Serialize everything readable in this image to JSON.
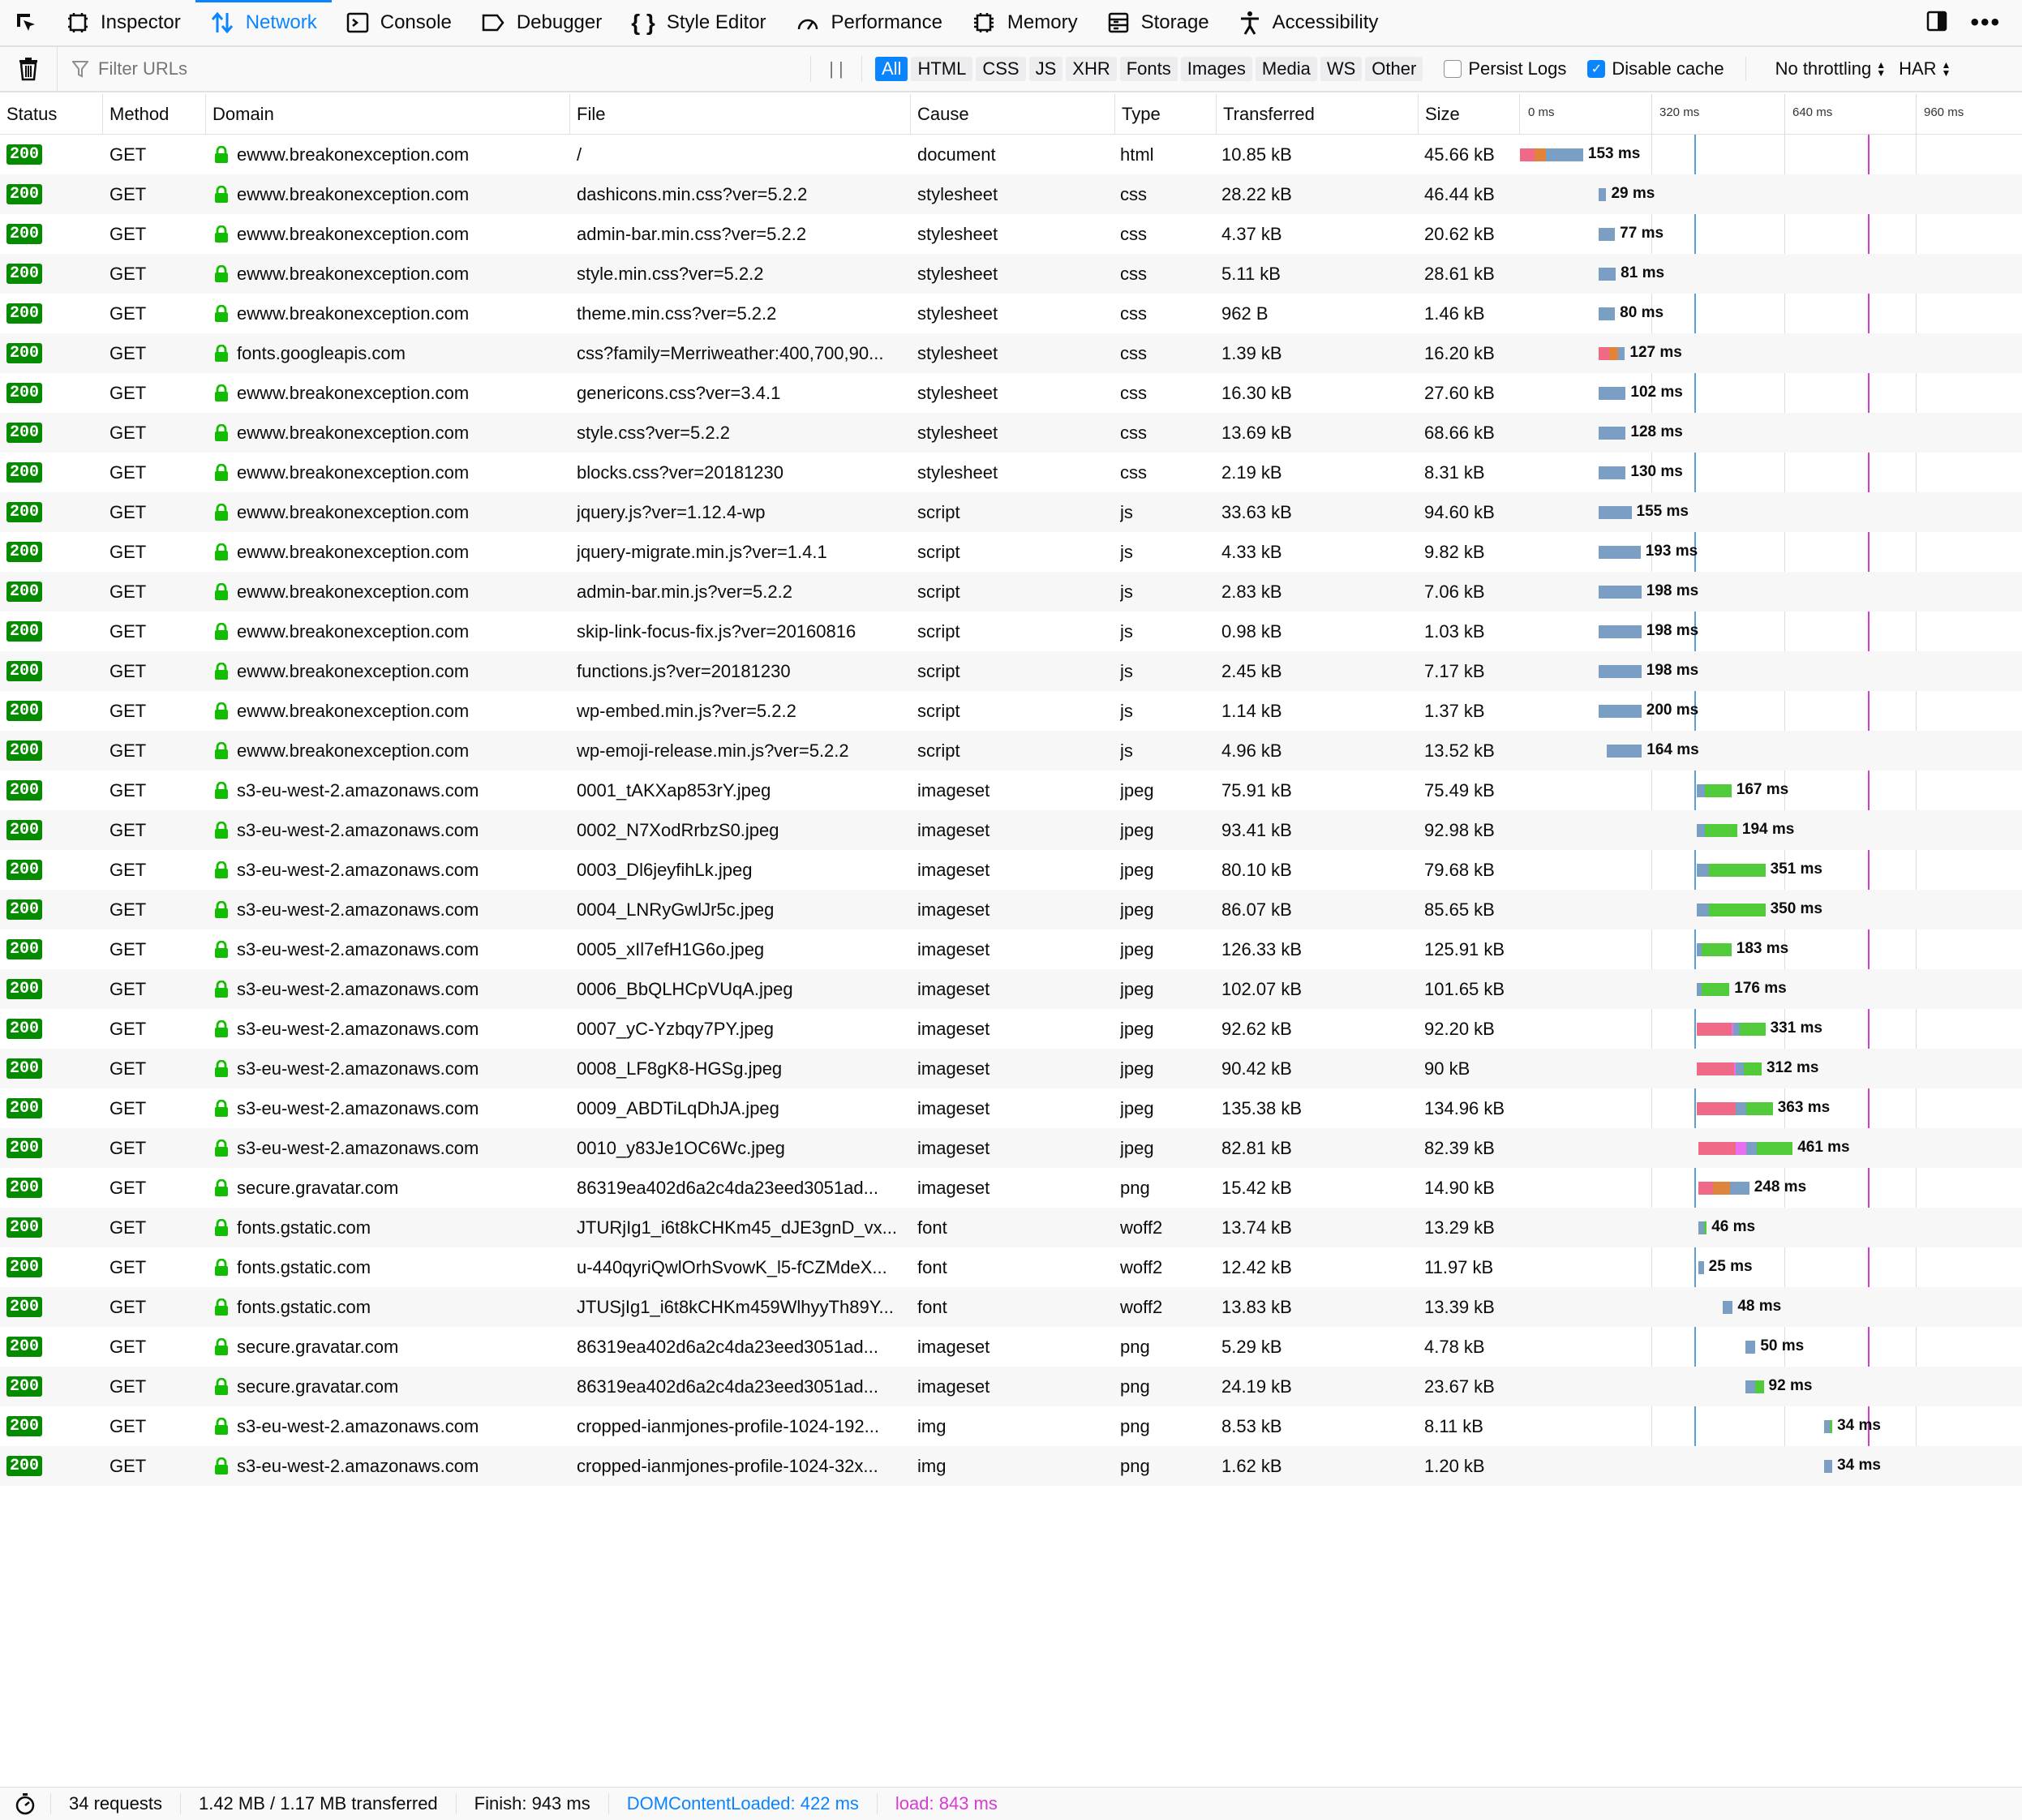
{
  "tabs": [
    {
      "label": "Inspector",
      "icon": "inspector-icon"
    },
    {
      "label": "Network",
      "icon": "network-icon",
      "selected": true
    },
    {
      "label": "Console",
      "icon": "console-icon"
    },
    {
      "label": "Debugger",
      "icon": "debugger-icon"
    },
    {
      "label": "Style Editor",
      "icon": "style-editor-icon"
    },
    {
      "label": "Performance",
      "icon": "performance-icon"
    },
    {
      "label": "Memory",
      "icon": "memory-icon"
    },
    {
      "label": "Storage",
      "icon": "storage-icon"
    },
    {
      "label": "Accessibility",
      "icon": "accessibility-icon"
    }
  ],
  "toolbar": {
    "filter_placeholder": "Filter URLs",
    "pause_label": "| |",
    "filter_types": [
      "All",
      "HTML",
      "CSS",
      "JS",
      "XHR",
      "Fonts",
      "Images",
      "Media",
      "WS",
      "Other"
    ],
    "selected_type": "All",
    "persist_logs": "Persist Logs",
    "persist_checked": false,
    "disable_cache": "Disable cache",
    "disable_checked": true,
    "throttling": "No throttling",
    "har": "HAR"
  },
  "columns": {
    "status": "Status",
    "method": "Method",
    "domain": "Domain",
    "file": "File",
    "cause": "Cause",
    "type": "Type",
    "transferred": "Transferred",
    "size": "Size"
  },
  "waterfall": {
    "ticks": [
      "0 ms",
      "320 ms",
      "640 ms",
      "960 ms"
    ],
    "dom_content_loaded_ms": 422,
    "load_ms": 843
  },
  "requests": [
    {
      "status": "200",
      "method": "GET",
      "domain": "ewww.breakonexception.com",
      "file": "/",
      "cause": "document",
      "type": "html",
      "transferred": "10.85 kB",
      "size": "45.66 kB",
      "timing": "153 ms"
    },
    {
      "status": "200",
      "method": "GET",
      "domain": "ewww.breakonexception.com",
      "file": "dashicons.min.css?ver=5.2.2",
      "cause": "stylesheet",
      "type": "css",
      "transferred": "28.22 kB",
      "size": "46.44 kB",
      "timing": "29 ms"
    },
    {
      "status": "200",
      "method": "GET",
      "domain": "ewww.breakonexception.com",
      "file": "admin-bar.min.css?ver=5.2.2",
      "cause": "stylesheet",
      "type": "css",
      "transferred": "4.37 kB",
      "size": "20.62 kB",
      "timing": "77 ms"
    },
    {
      "status": "200",
      "method": "GET",
      "domain": "ewww.breakonexception.com",
      "file": "style.min.css?ver=5.2.2",
      "cause": "stylesheet",
      "type": "css",
      "transferred": "5.11 kB",
      "size": "28.61 kB",
      "timing": "81 ms"
    },
    {
      "status": "200",
      "method": "GET",
      "domain": "ewww.breakonexception.com",
      "file": "theme.min.css?ver=5.2.2",
      "cause": "stylesheet",
      "type": "css",
      "transferred": "962 B",
      "size": "1.46 kB",
      "timing": "80 ms"
    },
    {
      "status": "200",
      "method": "GET",
      "domain": "fonts.googleapis.com",
      "file": "css?family=Merriweather:400,700,90...",
      "cause": "stylesheet",
      "type": "css",
      "transferred": "1.39 kB",
      "size": "16.20 kB",
      "timing": "127 ms"
    },
    {
      "status": "200",
      "method": "GET",
      "domain": "ewww.breakonexception.com",
      "file": "genericons.css?ver=3.4.1",
      "cause": "stylesheet",
      "type": "css",
      "transferred": "16.30 kB",
      "size": "27.60 kB",
      "timing": "102 ms"
    },
    {
      "status": "200",
      "method": "GET",
      "domain": "ewww.breakonexception.com",
      "file": "style.css?ver=5.2.2",
      "cause": "stylesheet",
      "type": "css",
      "transferred": "13.69 kB",
      "size": "68.66 kB",
      "timing": "128 ms"
    },
    {
      "status": "200",
      "method": "GET",
      "domain": "ewww.breakonexception.com",
      "file": "blocks.css?ver=20181230",
      "cause": "stylesheet",
      "type": "css",
      "transferred": "2.19 kB",
      "size": "8.31 kB",
      "timing": "130 ms"
    },
    {
      "status": "200",
      "method": "GET",
      "domain": "ewww.breakonexception.com",
      "file": "jquery.js?ver=1.12.4-wp",
      "cause": "script",
      "type": "js",
      "transferred": "33.63 kB",
      "size": "94.60 kB",
      "timing": "155 ms"
    },
    {
      "status": "200",
      "method": "GET",
      "domain": "ewww.breakonexception.com",
      "file": "jquery-migrate.min.js?ver=1.4.1",
      "cause": "script",
      "type": "js",
      "transferred": "4.33 kB",
      "size": "9.82 kB",
      "timing": "193 ms"
    },
    {
      "status": "200",
      "method": "GET",
      "domain": "ewww.breakonexception.com",
      "file": "admin-bar.min.js?ver=5.2.2",
      "cause": "script",
      "type": "js",
      "transferred": "2.83 kB",
      "size": "7.06 kB",
      "timing": "198 ms"
    },
    {
      "status": "200",
      "method": "GET",
      "domain": "ewww.breakonexception.com",
      "file": "skip-link-focus-fix.js?ver=20160816",
      "cause": "script",
      "type": "js",
      "transferred": "0.98 kB",
      "size": "1.03 kB",
      "timing": "198 ms"
    },
    {
      "status": "200",
      "method": "GET",
      "domain": "ewww.breakonexception.com",
      "file": "functions.js?ver=20181230",
      "cause": "script",
      "type": "js",
      "transferred": "2.45 kB",
      "size": "7.17 kB",
      "timing": "198 ms"
    },
    {
      "status": "200",
      "method": "GET",
      "domain": "ewww.breakonexception.com",
      "file": "wp-embed.min.js?ver=5.2.2",
      "cause": "script",
      "type": "js",
      "transferred": "1.14 kB",
      "size": "1.37 kB",
      "timing": "200 ms"
    },
    {
      "status": "200",
      "method": "GET",
      "domain": "ewww.breakonexception.com",
      "file": "wp-emoji-release.min.js?ver=5.2.2",
      "cause": "script",
      "type": "js",
      "transferred": "4.96 kB",
      "size": "13.52 kB",
      "timing": "164 ms"
    },
    {
      "status": "200",
      "method": "GET",
      "domain": "s3-eu-west-2.amazonaws.com",
      "file": "0001_tAKXap853rY.jpeg",
      "cause": "imageset",
      "type": "jpeg",
      "transferred": "75.91 kB",
      "size": "75.49 kB",
      "timing": "167 ms"
    },
    {
      "status": "200",
      "method": "GET",
      "domain": "s3-eu-west-2.amazonaws.com",
      "file": "0002_N7XodRrbzS0.jpeg",
      "cause": "imageset",
      "type": "jpeg",
      "transferred": "93.41 kB",
      "size": "92.98 kB",
      "timing": "194 ms"
    },
    {
      "status": "200",
      "method": "GET",
      "domain": "s3-eu-west-2.amazonaws.com",
      "file": "0003_Dl6jeyfihLk.jpeg",
      "cause": "imageset",
      "type": "jpeg",
      "transferred": "80.10 kB",
      "size": "79.68 kB",
      "timing": "351 ms"
    },
    {
      "status": "200",
      "method": "GET",
      "domain": "s3-eu-west-2.amazonaws.com",
      "file": "0004_LNRyGwlJr5c.jpeg",
      "cause": "imageset",
      "type": "jpeg",
      "transferred": "86.07 kB",
      "size": "85.65 kB",
      "timing": "350 ms"
    },
    {
      "status": "200",
      "method": "GET",
      "domain": "s3-eu-west-2.amazonaws.com",
      "file": "0005_xIl7efH1G6o.jpeg",
      "cause": "imageset",
      "type": "jpeg",
      "transferred": "126.33 kB",
      "size": "125.91 kB",
      "timing": "183 ms"
    },
    {
      "status": "200",
      "method": "GET",
      "domain": "s3-eu-west-2.amazonaws.com",
      "file": "0006_BbQLHCpVUqA.jpeg",
      "cause": "imageset",
      "type": "jpeg",
      "transferred": "102.07 kB",
      "size": "101.65 kB",
      "timing": "176 ms"
    },
    {
      "status": "200",
      "method": "GET",
      "domain": "s3-eu-west-2.amazonaws.com",
      "file": "0007_yC-Yzbqy7PY.jpeg",
      "cause": "imageset",
      "type": "jpeg",
      "transferred": "92.62 kB",
      "size": "92.20 kB",
      "timing": "331 ms"
    },
    {
      "status": "200",
      "method": "GET",
      "domain": "s3-eu-west-2.amazonaws.com",
      "file": "0008_LF8gK8-HGSg.jpeg",
      "cause": "imageset",
      "type": "jpeg",
      "transferred": "90.42 kB",
      "size": "90 kB",
      "timing": "312 ms"
    },
    {
      "status": "200",
      "method": "GET",
      "domain": "s3-eu-west-2.amazonaws.com",
      "file": "0009_ABDTiLqDhJA.jpeg",
      "cause": "imageset",
      "type": "jpeg",
      "transferred": "135.38 kB",
      "size": "134.96 kB",
      "timing": "363 ms"
    },
    {
      "status": "200",
      "method": "GET",
      "domain": "s3-eu-west-2.amazonaws.com",
      "file": "0010_y83Je1OC6Wc.jpeg",
      "cause": "imageset",
      "type": "jpeg",
      "transferred": "82.81 kB",
      "size": "82.39 kB",
      "timing": "461 ms"
    },
    {
      "status": "200",
      "method": "GET",
      "domain": "secure.gravatar.com",
      "file": "86319ea402d6a2c4da23eed3051ad...",
      "cause": "imageset",
      "type": "png",
      "transferred": "15.42 kB",
      "size": "14.90 kB",
      "timing": "248 ms"
    },
    {
      "status": "200",
      "method": "GET",
      "domain": "fonts.gstatic.com",
      "file": "JTURjIg1_i6t8kCHKm45_dJE3gnD_vx...",
      "cause": "font",
      "type": "woff2",
      "transferred": "13.74 kB",
      "size": "13.29 kB",
      "timing": "46 ms"
    },
    {
      "status": "200",
      "method": "GET",
      "domain": "fonts.gstatic.com",
      "file": "u-440qyriQwlOrhSvowK_l5-fCZMdeX...",
      "cause": "font",
      "type": "woff2",
      "transferred": "12.42 kB",
      "size": "11.97 kB",
      "timing": "25 ms"
    },
    {
      "status": "200",
      "method": "GET",
      "domain": "fonts.gstatic.com",
      "file": "JTUSjIg1_i6t8kCHKm459WlhyyTh89Y...",
      "cause": "font",
      "type": "woff2",
      "transferred": "13.83 kB",
      "size": "13.39 kB",
      "timing": "48 ms"
    },
    {
      "status": "200",
      "method": "GET",
      "domain": "secure.gravatar.com",
      "file": "86319ea402d6a2c4da23eed3051ad...",
      "cause": "imageset",
      "type": "png",
      "transferred": "5.29 kB",
      "size": "4.78 kB",
      "timing": "50 ms"
    },
    {
      "status": "200",
      "method": "GET",
      "domain": "secure.gravatar.com",
      "file": "86319ea402d6a2c4da23eed3051ad...",
      "cause": "imageset",
      "type": "png",
      "transferred": "24.19 kB",
      "size": "23.67 kB",
      "timing": "92 ms"
    },
    {
      "status": "200",
      "method": "GET",
      "domain": "s3-eu-west-2.amazonaws.com",
      "file": "cropped-ianmjones-profile-1024-192...",
      "cause": "img",
      "type": "png",
      "transferred": "8.53 kB",
      "size": "8.11 kB",
      "timing": "34 ms"
    },
    {
      "status": "200",
      "method": "GET",
      "domain": "s3-eu-west-2.amazonaws.com",
      "file": "cropped-ianmjones-profile-1024-32x...",
      "cause": "img",
      "type": "png",
      "transferred": "1.62 kB",
      "size": "1.20 kB",
      "timing": "34 ms"
    }
  ],
  "footer": {
    "requests": "34 requests",
    "size": "1.42 MB / 1.17 MB transferred",
    "finish": "Finish: 943 ms",
    "dcl": "DOMContentLoaded: 422 ms",
    "load": "load: 843 ms"
  },
  "colors": {
    "accent": "#0a84ff",
    "status_ok": "#058b00",
    "dns": "#f06a87",
    "connect": "#e0843c",
    "tls": "#e86ff2",
    "wait": "#7a9ec4",
    "receive": "#52cb3a",
    "dcl_line": "#5aa0d8",
    "load_line": "#d83ad2"
  }
}
